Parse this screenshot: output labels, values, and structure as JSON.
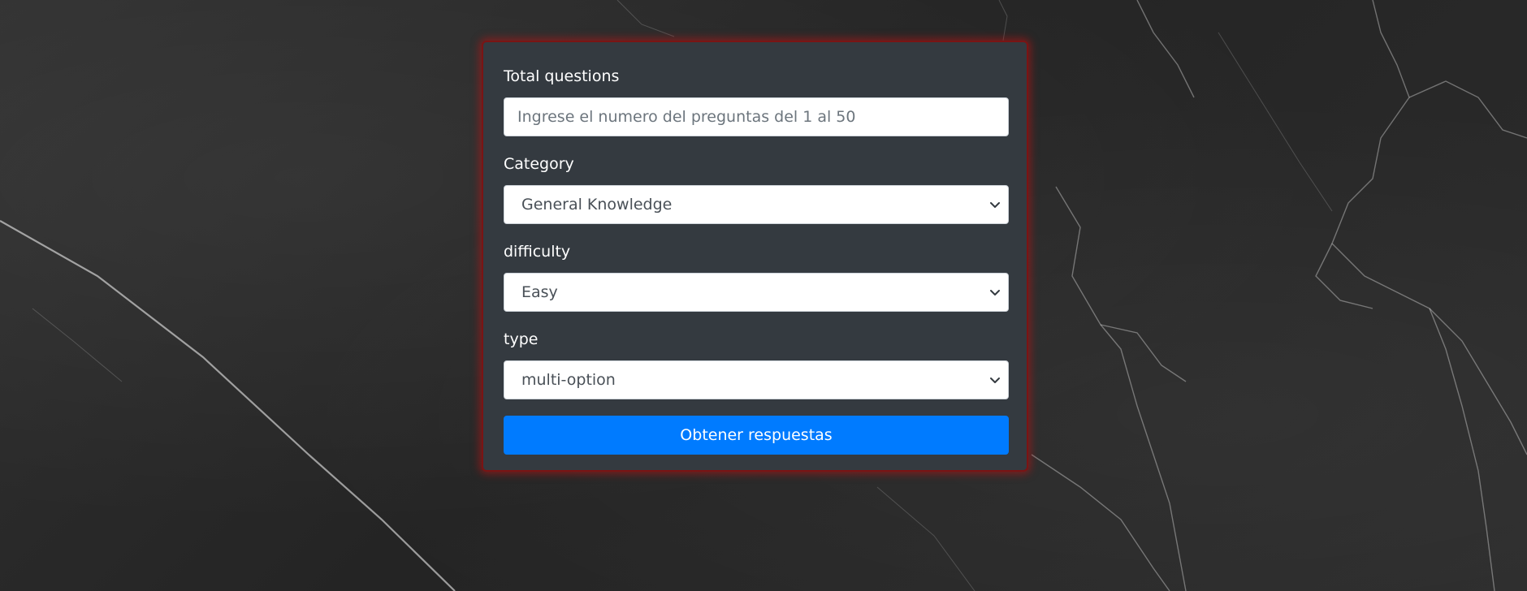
{
  "form": {
    "total_questions": {
      "label": "Total questions",
      "value": "",
      "placeholder": "Ingrese el numero del preguntas del 1 al 50"
    },
    "category": {
      "label": "Category",
      "selected": "General Knowledge"
    },
    "difficulty": {
      "label": "difficulty",
      "selected": "Easy"
    },
    "type": {
      "label": "type",
      "selected": "multi-option"
    },
    "submit_label": "Obtener respuestas"
  },
  "theme": {
    "card_background": "#343a40",
    "card_glow": "#be1414",
    "button_color": "#007bff",
    "page_background": "#2a2a2a"
  },
  "icons": {
    "select_arrow": "chevron-down-icon"
  }
}
